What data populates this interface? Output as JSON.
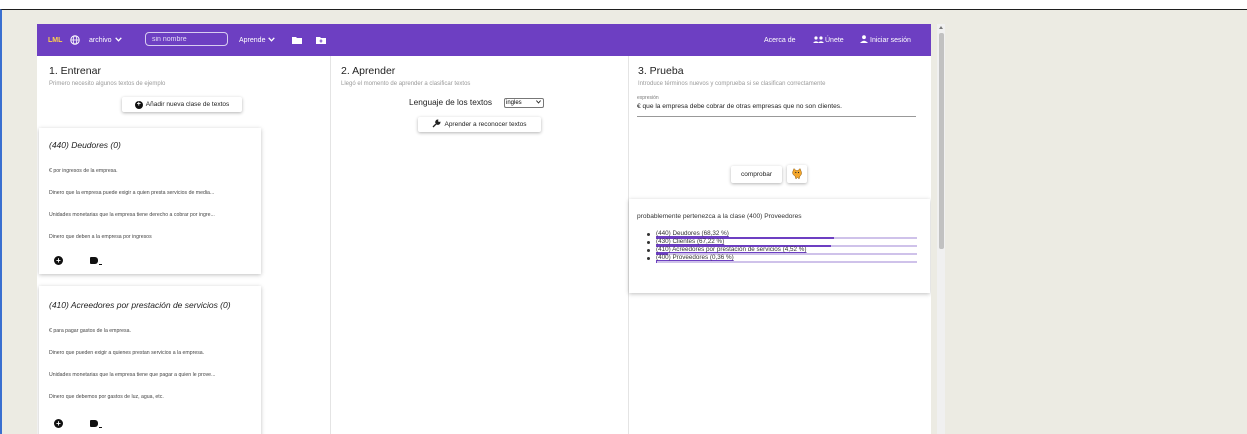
{
  "appbar": {
    "logo": "LML",
    "file_menu": "archivo",
    "name_placeholder": "sin nombre",
    "learn_menu": "Aprende",
    "about": "Acerca de",
    "users_label": "Únete",
    "login": "Iniciar sesión",
    "bg_color": "#6d3fc2"
  },
  "train": {
    "title": "1. Entrenar",
    "subtitle": "Primero necesito algunos textos de ejemplo",
    "add_class_button": "Añadir nueva clase de textos",
    "cards": [
      {
        "title": "(440) Deudores (0)",
        "examples": [
          "€ por ingresos de la empresa.",
          "Dinero que la empresa puede exigir a quien presta servicios de media...",
          "Unidades monetarias que la empresa tiene derecho a cobrar por ingre...",
          "Dinero que deben a la empresa por ingresos"
        ]
      },
      {
        "title": "(410) Acreedores por prestación de servicios (0)",
        "examples": [
          "€ para pagar gastos de la empresa.",
          "Dinero que pueden exigir a quienes prestan servicios a la empresa.",
          "Unidades monetarias que la empresa tiene que pagar a quien le prove...",
          "Dinero que debemos por gastos de luz, agua, etc."
        ]
      }
    ]
  },
  "learn": {
    "title": "2. Aprender",
    "subtitle": "Llegó el momento de aprender a clasificar textos",
    "language_label": "Lenguaje de los textos",
    "language_value": "ingles",
    "learn_button": "Aprender a reconocer textos"
  },
  "test": {
    "title": "3. Prueba",
    "subtitle": "Introduce términos nuevos y comprueba si se clasifican correctamente",
    "field_label": "expresión",
    "field_value": "€ que la empresa debe cobrar de otras empresas que no son clientes.",
    "check_button": "comprobar",
    "prediction": "probablemente pertenezca a la clase (400) Proveedores",
    "results": [
      {
        "label": "(440) Deudores (68,32 %)",
        "percent": 68.32
      },
      {
        "label": "(430) Clientes (67,22 %)",
        "percent": 67.22
      },
      {
        "label": "(410) Acreedores por prestación de servicios (4,52 %)",
        "percent": 4.52
      },
      {
        "label": "(400) Proveedores (0,36 %)",
        "percent": 0.36
      }
    ]
  }
}
